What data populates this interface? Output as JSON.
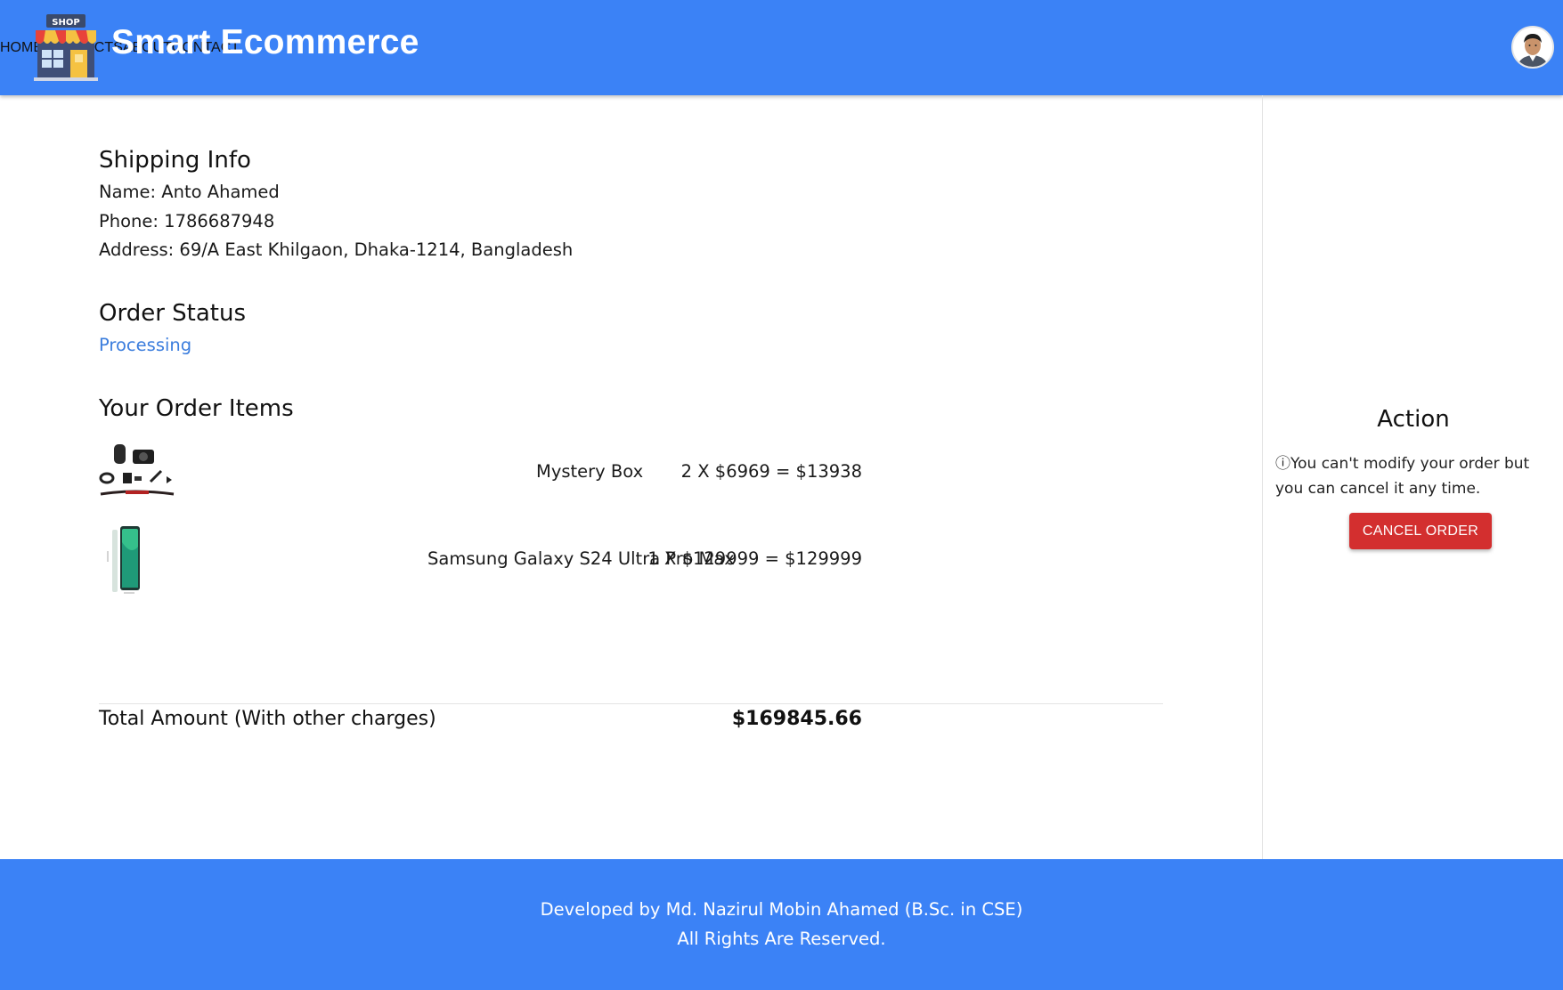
{
  "header": {
    "brand": "Smart Ecommerce",
    "logo_sign": "SHOP",
    "nav": [
      "HOME",
      "PRODUCTS",
      "ABOUT",
      "CONTACT"
    ]
  },
  "shipping": {
    "title": "Shipping Info",
    "name": "Name: Anto Ahamed",
    "phone": "Phone: 1786687948",
    "address": "Address: 69/A East Khilgaon, Dhaka-1214, Bangladesh"
  },
  "order_status": {
    "title": "Order Status",
    "status": "Processing"
  },
  "items": {
    "title": "Your Order Items",
    "list": [
      {
        "name": "Mystery Box",
        "price": "2 X $6969 = $13938",
        "icon": "mystery-box-product-icon"
      },
      {
        "name": "Samsung Galaxy S24 Ultra Pro Max",
        "price": "1 X $129999 = $129999",
        "icon": "smartphone-product-icon"
      }
    ],
    "total_label": "Total Amount (With other charges)",
    "total_value": "$169845.66"
  },
  "action": {
    "title": "Action",
    "note": "ⓘYou can't modify your order but you can cancel it any time.",
    "cancel_label": "CANCEL ORDER"
  },
  "footer": {
    "line1": "Developed by Md. Nazirul Mobin Ahamed (B.Sc. in CSE)",
    "line2": "All Rights Are Reserved."
  },
  "colors": {
    "primary": "#3b82f6",
    "danger": "#d32f2f",
    "status": "#3b7ddd"
  }
}
